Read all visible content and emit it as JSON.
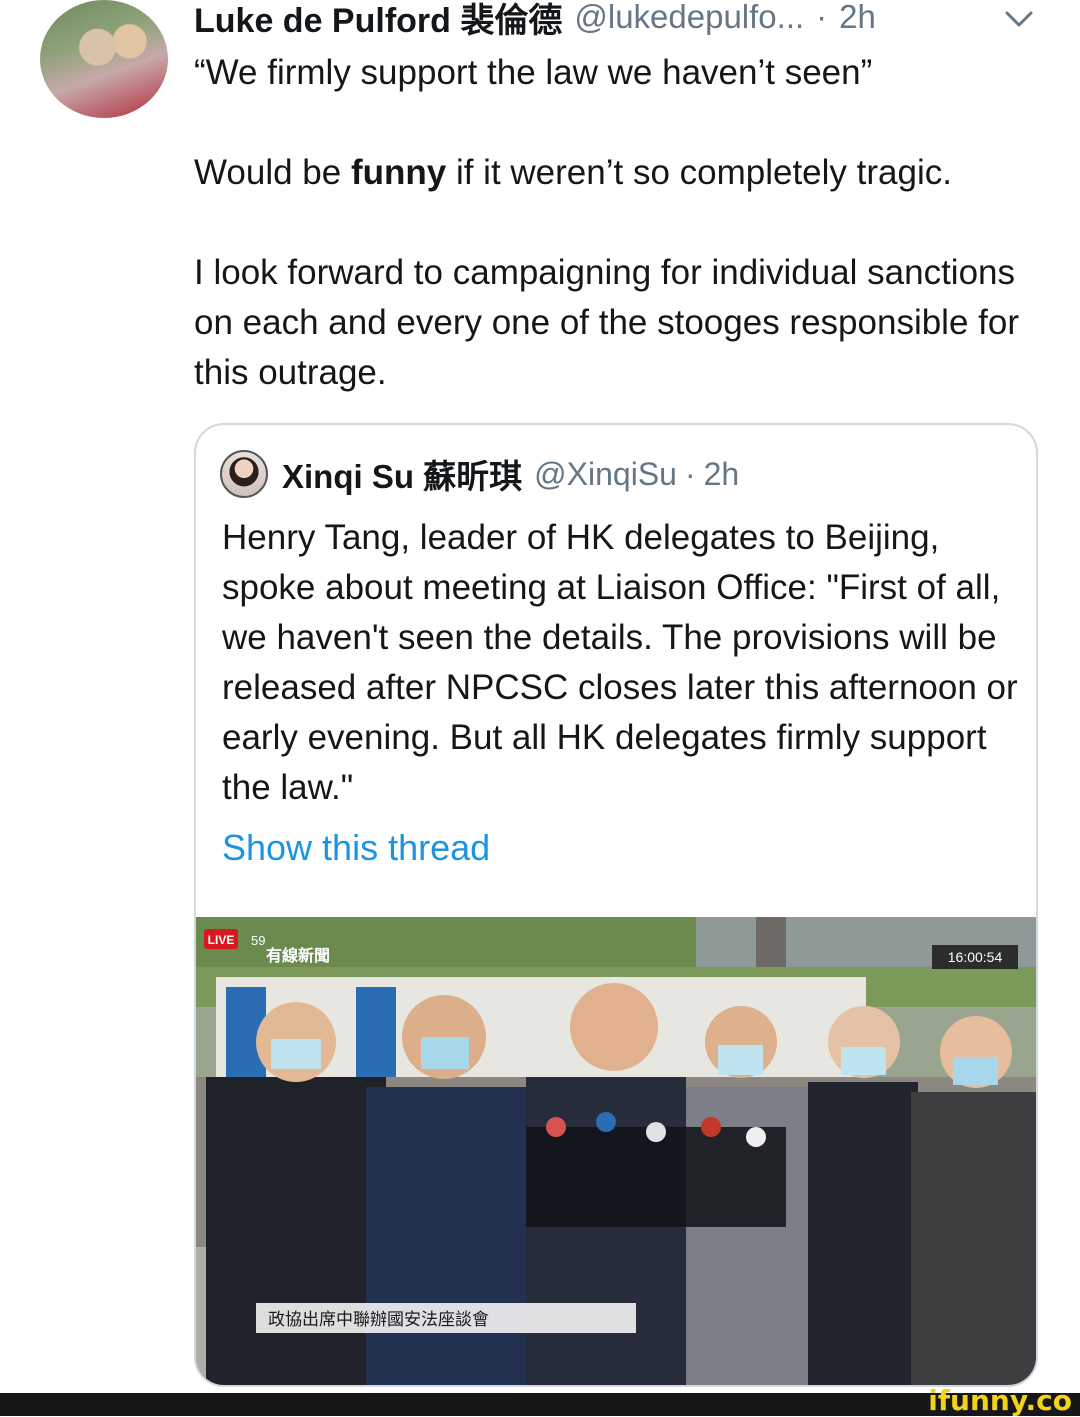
{
  "tweet": {
    "author_name": "Luke de Pulford 裴倫德",
    "author_handle": "@lukedepulfo...",
    "separator": "·",
    "time": "2h",
    "chevron_icon": "chevron-down-icon",
    "lines": [
      "“We firmly support the law we haven’t seen”"
    ],
    "line2_before": "Would be ",
    "line2_bold": "funny",
    "line2_after": " if it weren’t so completely tragic.",
    "line3": "I look forward to campaigning for individual sanctions on each and every one of the stooges responsible for this outrage."
  },
  "quote": {
    "author_name": "Xinqi Su 蘇昕琪",
    "author_handle": "@XinqiSu",
    "separator": "·",
    "time": "2h",
    "text": "Henry Tang, leader of HK delegates to Beijing, spoke about meeting at Liaison Office: \"First of all, we haven't seen the details. The provisions will be released after NPCSC closes later this afternoon or early evening. But all HK delegates firmly support the law.\"",
    "show_thread": "Show this thread",
    "media": {
      "live_badge": "LIVE",
      "viewer_count": "59",
      "channel_logo": "有線新聞",
      "timestamp": "16:00:54",
      "caption": "政協出席中聯辦國安法座談會"
    }
  },
  "watermark": "ifunny.co",
  "colors": {
    "text": "#14171a",
    "secondary": "#657786",
    "link": "#1b95e0",
    "border": "#cfd9de"
  }
}
